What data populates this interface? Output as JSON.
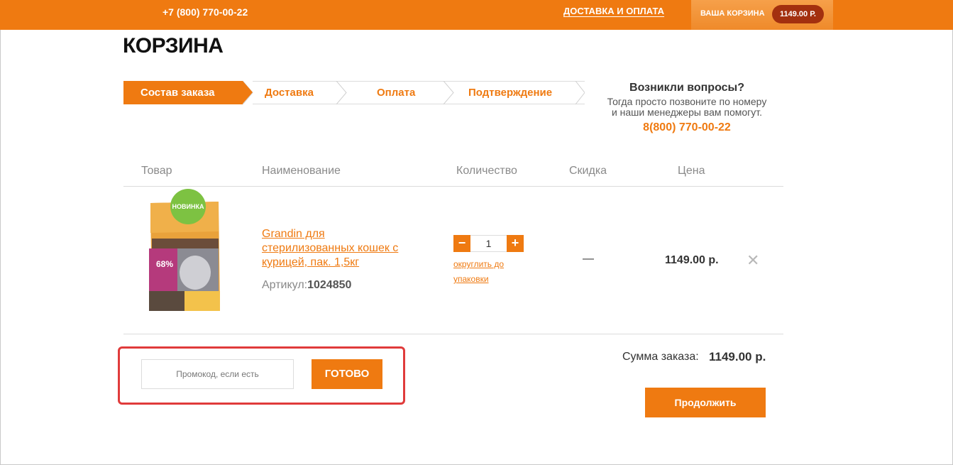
{
  "header": {
    "phone": "+7 (800) 770-00-22",
    "delivery_link": "ДОСТАВКА И ОПЛАТА",
    "cart_label": "ВАША КОРЗИНА",
    "cart_total": "1149.00 Р."
  },
  "page_title": "КОРЗИНА",
  "steps": [
    {
      "label": "Состав заказа",
      "active": true
    },
    {
      "label": "Доставка",
      "active": false
    },
    {
      "label": "Оплата",
      "active": false
    },
    {
      "label": "Подтверждение",
      "active": false
    }
  ],
  "help": {
    "question": "Возникли вопросы?",
    "text": "Тогда просто позвоните по номеру и наши менеджеры вам помогут.",
    "phone": "8(800) 770-00-22"
  },
  "table": {
    "headers": [
      "Товар",
      "Наименование",
      "Количество",
      "Скидка",
      "Цена"
    ]
  },
  "item": {
    "badge": "НОВИНКА",
    "name": "Grandin для стерилизованных кошек с курицей, пак. 1,5кг",
    "sku_label": "Артикул:",
    "sku_value": "1024850",
    "quantity": "1",
    "round_link": "округлить до упаковки",
    "discount": "—",
    "price": "1149.00 р.",
    "remove_symbol": "✕"
  },
  "promo": {
    "placeholder": "Промокод, если есть",
    "button": "ГОТОВО"
  },
  "summary": {
    "label": "Сумма заказа:",
    "value": "1149.00 р.",
    "continue": "Продолжить"
  },
  "colors": {
    "accent": "#ef7a11",
    "highlight_border": "#e03b3b",
    "badge_green": "#7dc242"
  }
}
